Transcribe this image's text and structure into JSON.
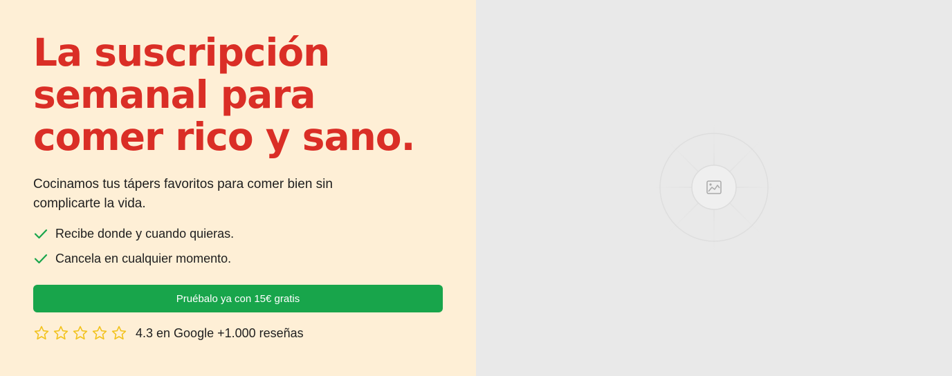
{
  "hero": {
    "headline_lines": [
      "La suscripción",
      "semanal para",
      "comer rico y sano."
    ],
    "subtitle": "Cocinamos tus tápers favoritos para comer bien sin complicarte la vida.",
    "benefits": [
      {
        "label": "Recibe donde y cuando quieras.",
        "icon": "check-icon"
      },
      {
        "label": "Cancela en cualquier momento.",
        "icon": "check-icon"
      }
    ],
    "cta_label": "Pruébalo ya con 15€ gratis",
    "rating": {
      "stars_total": 5,
      "icon": "star-outline-icon",
      "text": "4.3 en Google +1.000 reseñas"
    }
  },
  "media": {
    "icon": "image-placeholder-icon"
  },
  "colors": {
    "left_background": "#FEEFD6",
    "right_background": "#E9E9E9",
    "headline": "#DA2E26",
    "cta_background": "#18A54B",
    "check": "#18A54B",
    "star": "#F2C21B"
  }
}
